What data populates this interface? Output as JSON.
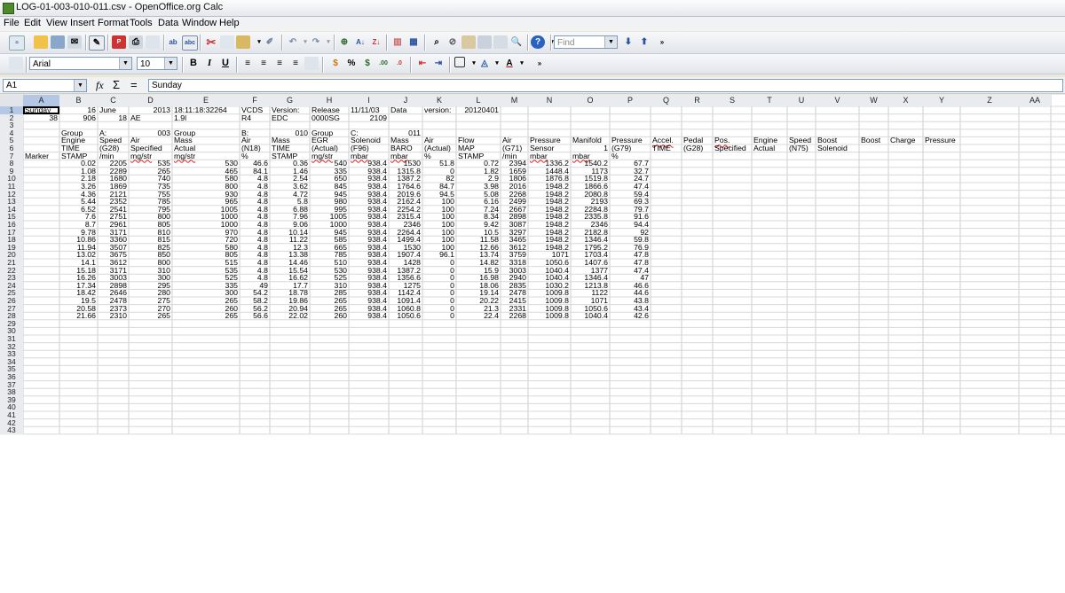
{
  "window": {
    "title": "LOG-01-003-010-011.csv - OpenOffice.org Calc"
  },
  "menu": [
    "File",
    "Edit",
    "View",
    "Insert",
    "Format",
    "Tools",
    "Data",
    "Window",
    "Help"
  ],
  "toolbar": {
    "find_placeholder": "Find",
    "font_name": "Arial",
    "font_size": "10",
    "bold_label": "B",
    "italic_label": "I",
    "underline_label": "U",
    "currency_label": "%",
    "more_label": "»"
  },
  "formula_bar": {
    "cell_ref": "A1",
    "fx_label": "fx",
    "sum_label": "Σ",
    "equals_label": "=",
    "content": "Sunday"
  },
  "columns": [
    "A",
    "B",
    "C",
    "D",
    "E",
    "F",
    "G",
    "H",
    "I",
    "J",
    "K",
    "L",
    "M",
    "N",
    "O",
    "P",
    "Q",
    "R",
    "S",
    "T",
    "U",
    "V",
    "W",
    "X",
    "Y",
    "Z",
    "AA"
  ],
  "rows": [
    "1",
    "2",
    "3",
    "4",
    "5",
    "6",
    "7",
    "8",
    "9",
    "10",
    "11",
    "12",
    "13",
    "14",
    "15",
    "16",
    "17",
    "18",
    "19",
    "20",
    "21",
    "22",
    "23",
    "24",
    "25",
    "26",
    "27",
    "28",
    "29",
    "30",
    "31",
    "32",
    "33",
    "34",
    "35",
    "36",
    "37",
    "38",
    "39",
    "40",
    "41",
    "42",
    "43"
  ],
  "selected_cell": "A1",
  "sheet": [
    [
      "Sunday",
      "16",
      "June",
      "2013",
      "18:11:18:32264",
      "VCDS",
      "Version:",
      "Release",
      "11/11/03",
      "Data",
      "version:",
      "20120401"
    ],
    [
      "38",
      "906",
      "18",
      "AE",
      "1.9l",
      "R4",
      "EDC",
      "0000SG",
      "2109"
    ],
    [],
    [
      "",
      "Group",
      "A:",
      "003",
      "Group",
      "B:",
      "010",
      "Group",
      "C:",
      "011"
    ],
    [
      "",
      "Engine",
      "Speed",
      "Air",
      "Mass",
      "Air",
      "Mass",
      "EGR",
      "Solenoid",
      "Mass",
      "Air",
      "Flow",
      "Air",
      "Pressure",
      "Manifold",
      "Pressure",
      "Accel.",
      "Pedal",
      "Pos.",
      "Engine",
      "Speed",
      "Boost",
      "Boost",
      "Charge",
      "Pressure"
    ],
    [
      "",
      "TIME",
      "(G28)",
      "Specified",
      "Actual",
      "(N18)",
      "TIME",
      "(Actual)",
      "(F96)",
      "BARO",
      "(Actual)",
      "MAP",
      "(G71)",
      "Sensor",
      "1",
      "(G79)",
      "TIME",
      "(G28)",
      "Specified",
      "Actual",
      "(N75)",
      "Solenoid"
    ],
    [
      "Marker",
      "STAMP",
      "/min",
      "mg/str",
      "mg/str",
      "%",
      "STAMP",
      "mg/str",
      "mbar",
      "mbar",
      "%",
      "STAMP",
      "/min",
      "mbar",
      "mbar",
      "%"
    ],
    [
      "",
      "0.02",
      "2205",
      "535",
      "530",
      "46.6",
      "0.36",
      "540",
      "938.4",
      "1530",
      "51.8",
      "0.72",
      "2394",
      "1336.2",
      "1540.2",
      "67.7"
    ],
    [
      "",
      "1.08",
      "2289",
      "265",
      "465",
      "84.1",
      "1.46",
      "335",
      "938.4",
      "1315.8",
      "0",
      "1.82",
      "1659",
      "1448.4",
      "1173",
      "32.7"
    ],
    [
      "",
      "2.18",
      "1680",
      "740",
      "580",
      "4.8",
      "2.54",
      "650",
      "938.4",
      "1387.2",
      "82",
      "2.9",
      "1806",
      "1876.8",
      "1519.8",
      "24.7"
    ],
    [
      "",
      "3.26",
      "1869",
      "735",
      "800",
      "4.8",
      "3.62",
      "845",
      "938.4",
      "1764.6",
      "84.7",
      "3.98",
      "2016",
      "1948.2",
      "1866.6",
      "47.4"
    ],
    [
      "",
      "4.36",
      "2121",
      "755",
      "930",
      "4.8",
      "4.72",
      "945",
      "938.4",
      "2019.6",
      "94.5",
      "5.08",
      "2268",
      "1948.2",
      "2080.8",
      "59.4"
    ],
    [
      "",
      "5.44",
      "2352",
      "785",
      "965",
      "4.8",
      "5.8",
      "980",
      "938.4",
      "2162.4",
      "100",
      "6.16",
      "2499",
      "1948.2",
      "2193",
      "69.3"
    ],
    [
      "",
      "6.52",
      "2541",
      "795",
      "1005",
      "4.8",
      "6.88",
      "995",
      "938.4",
      "2254.2",
      "100",
      "7.24",
      "2667",
      "1948.2",
      "2284.8",
      "79.7"
    ],
    [
      "",
      "7.6",
      "2751",
      "800",
      "1000",
      "4.8",
      "7.96",
      "1005",
      "938.4",
      "2315.4",
      "100",
      "8.34",
      "2898",
      "1948.2",
      "2335.8",
      "91.6"
    ],
    [
      "",
      "8.7",
      "2961",
      "805",
      "1000",
      "4.8",
      "9.06",
      "1000",
      "938.4",
      "2346",
      "100",
      "9.42",
      "3087",
      "1948.2",
      "2346",
      "94.4"
    ],
    [
      "",
      "9.78",
      "3171",
      "810",
      "970",
      "4.8",
      "10.14",
      "945",
      "938.4",
      "2264.4",
      "100",
      "10.5",
      "3297",
      "1948.2",
      "2182.8",
      "92"
    ],
    [
      "",
      "10.86",
      "3360",
      "815",
      "720",
      "4.8",
      "11.22",
      "585",
      "938.4",
      "1499.4",
      "100",
      "11.58",
      "3465",
      "1948.2",
      "1346.4",
      "59.8"
    ],
    [
      "",
      "11.94",
      "3507",
      "825",
      "580",
      "4.8",
      "12.3",
      "665",
      "938.4",
      "1530",
      "100",
      "12.66",
      "3612",
      "1948.2",
      "1795.2",
      "76.9"
    ],
    [
      "",
      "13.02",
      "3675",
      "850",
      "805",
      "4.8",
      "13.38",
      "785",
      "938.4",
      "1907.4",
      "96.1",
      "13.74",
      "3759",
      "1071",
      "1703.4",
      "47.8"
    ],
    [
      "",
      "14.1",
      "3612",
      "800",
      "515",
      "4.8",
      "14.46",
      "510",
      "938.4",
      "1428",
      "0",
      "14.82",
      "3318",
      "1050.6",
      "1407.6",
      "47.8"
    ],
    [
      "",
      "15.18",
      "3171",
      "310",
      "535",
      "4.8",
      "15.54",
      "530",
      "938.4",
      "1387.2",
      "0",
      "15.9",
      "3003",
      "1040.4",
      "1377",
      "47.4"
    ],
    [
      "",
      "16.26",
      "3003",
      "300",
      "525",
      "4.8",
      "16.62",
      "525",
      "938.4",
      "1356.6",
      "0",
      "16.98",
      "2940",
      "1040.4",
      "1346.4",
      "47"
    ],
    [
      "",
      "17.34",
      "2898",
      "295",
      "335",
      "49",
      "17.7",
      "310",
      "938.4",
      "1275",
      "0",
      "18.06",
      "2835",
      "1030.2",
      "1213.8",
      "46.6"
    ],
    [
      "",
      "18.42",
      "2646",
      "280",
      "300",
      "54.2",
      "18.78",
      "285",
      "938.4",
      "1142.4",
      "0",
      "19.14",
      "2478",
      "1009.8",
      "1122",
      "44.6"
    ],
    [
      "",
      "19.5",
      "2478",
      "275",
      "265",
      "58.2",
      "19.86",
      "265",
      "938.4",
      "1091.4",
      "0",
      "20.22",
      "2415",
      "1009.8",
      "1071",
      "43.8"
    ],
    [
      "",
      "20.58",
      "2373",
      "270",
      "260",
      "56.2",
      "20.94",
      "265",
      "938.4",
      "1060.8",
      "0",
      "21.3",
      "2331",
      "1009.8",
      "1050.6",
      "43.4"
    ],
    [
      "",
      "21.66",
      "2310",
      "265",
      "265",
      "56.6",
      "22.02",
      "260",
      "938.4",
      "1050.6",
      "0",
      "22.4",
      "2268",
      "1009.8",
      "1040.4",
      "42.6"
    ]
  ]
}
